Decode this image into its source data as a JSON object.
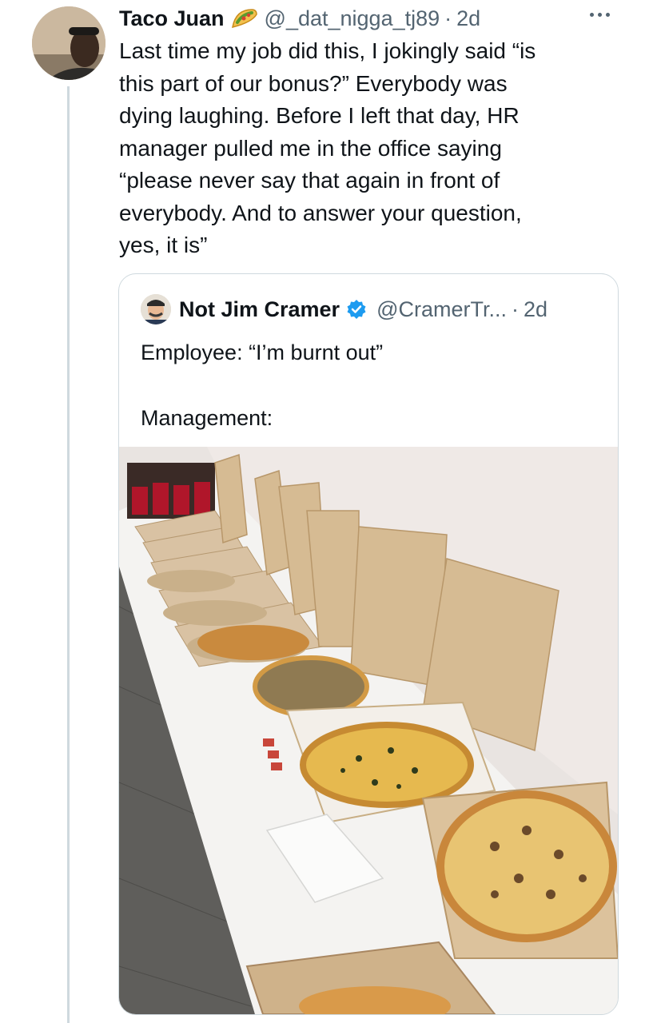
{
  "tweet": {
    "author_name": "Taco Juan",
    "author_emoji_icon": "taco-icon",
    "handle": "@_dat_nigga_tj89",
    "separator": "·",
    "time": "2d",
    "more_icon": "more-horizontal-icon",
    "text": "Last time my job did this, I jokingly said “is\nthis part of our bonus?” Everybody was\ndying laughing. Before I left that day, HR\nmanager pulled me in the office saying\n“please never say that again in front of\neverybody. And to answer your question,\nyes, it is”"
  },
  "quote": {
    "author_name": "Not Jim Cramer",
    "verified_icon": "verified-badge-icon",
    "handle": "@CramerTr...",
    "separator": "·",
    "time": "2d",
    "text": "Employee: “I’m burnt out”\n\nManagement:",
    "image_icon": "photo-pizzas-on-table"
  },
  "colors": {
    "text_primary": "#0f1419",
    "text_secondary": "#536471",
    "border": "#cfd9de",
    "verified_blue": "#1d9bf0"
  }
}
